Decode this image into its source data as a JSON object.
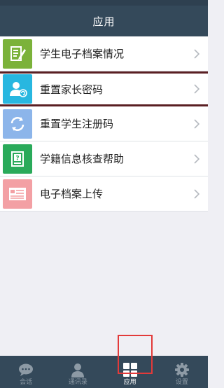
{
  "header": {
    "title": "应用"
  },
  "list": {
    "items": [
      {
        "label": "学生电子档案情况",
        "icon": "document-edit-icon",
        "color": "#7bb23a"
      },
      {
        "label": "重置家长密码",
        "icon": "user-refresh-icon",
        "color": "#28b7e0"
      },
      {
        "label": "重置学生注册码",
        "icon": "refresh-icon",
        "color": "#8cb5ea"
      },
      {
        "label": "学籍信息核查帮助",
        "icon": "help-document-icon",
        "color": "#2aaa5a"
      },
      {
        "label": "电子档案上传",
        "icon": "upload-card-icon",
        "color": "#f3a0a4"
      }
    ]
  },
  "tabbar": {
    "tabs": [
      {
        "label": "会话",
        "icon": "chat-icon",
        "active": false
      },
      {
        "label": "通讯录",
        "icon": "contacts-icon",
        "active": false
      },
      {
        "label": "应用",
        "icon": "apps-grid-icon",
        "active": true
      },
      {
        "label": "设置",
        "icon": "gear-icon",
        "active": false
      }
    ]
  },
  "colors": {
    "header_bg": "#34495a",
    "highlight": "#e23a3a",
    "separator": "#5a1f23"
  }
}
